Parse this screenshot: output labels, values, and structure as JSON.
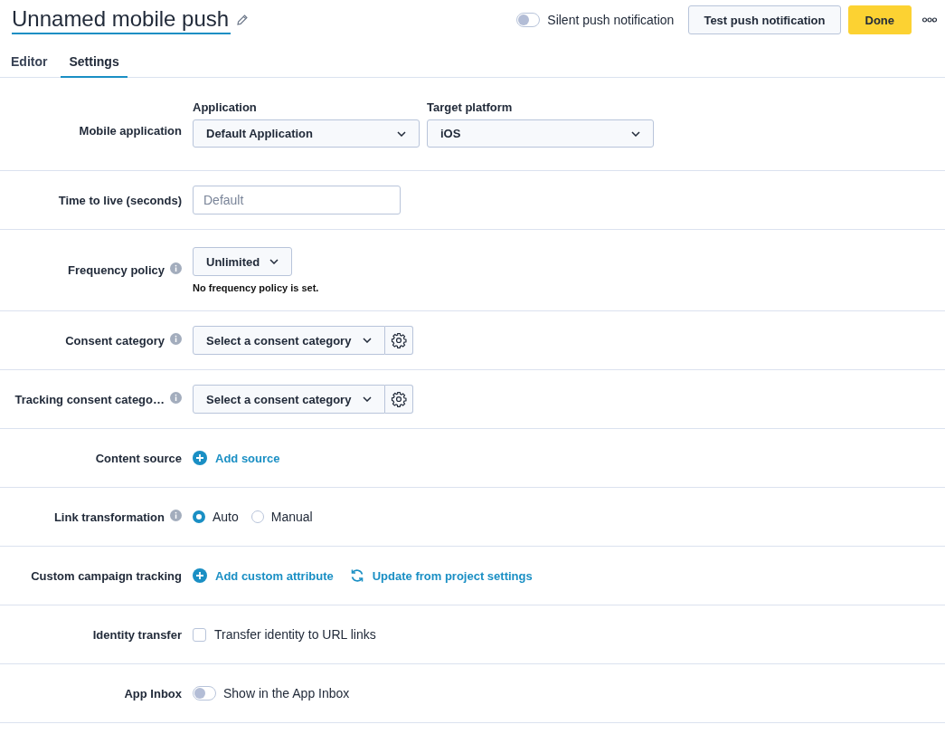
{
  "header": {
    "title": "Unnamed mobile push",
    "silent_toggle": {
      "label": "Silent push notification",
      "on": false
    },
    "test_button": "Test push notification",
    "done_button": "Done"
  },
  "tabs": [
    {
      "label": "Editor",
      "selected": false
    },
    {
      "label": "Settings",
      "selected": true
    }
  ],
  "rows": [
    {
      "kind": "selects",
      "label": "Mobile application",
      "fields": [
        {
          "label": "Application",
          "value": "Default Application"
        },
        {
          "label": "Target platform",
          "value": "iOS"
        }
      ]
    },
    {
      "kind": "input",
      "label": "Time to live (seconds)",
      "placeholder": "Default"
    },
    {
      "kind": "dropdown",
      "label": "Frequency policy",
      "info": true,
      "value": "Unlimited",
      "note": "No frequency policy is set."
    },
    {
      "kind": "consent",
      "label": "Consent category",
      "info": true,
      "value": "Select a consent category"
    },
    {
      "kind": "consent",
      "label": "Tracking consent catego…",
      "info": true,
      "value": "Select a consent category"
    },
    {
      "kind": "actions",
      "label": "Content source",
      "actions": [
        {
          "kind": "add",
          "label": "Add source"
        }
      ]
    },
    {
      "kind": "radios",
      "label": "Link transformation",
      "info": true,
      "options": [
        {
          "label": "Auto",
          "selected": true
        },
        {
          "label": "Manual",
          "selected": false
        }
      ]
    },
    {
      "kind": "actions",
      "label": "Custom campaign tracking",
      "actions": [
        {
          "kind": "add",
          "label": "Add custom attribute"
        },
        {
          "kind": "sync",
          "label": "Update from project settings"
        }
      ]
    },
    {
      "kind": "checkbox",
      "label": "Identity transfer",
      "text": "Transfer identity to URL links",
      "checked": false
    },
    {
      "kind": "toggle",
      "label": "App Inbox",
      "text": "Show in the App Inbox",
      "on": false
    }
  ]
}
